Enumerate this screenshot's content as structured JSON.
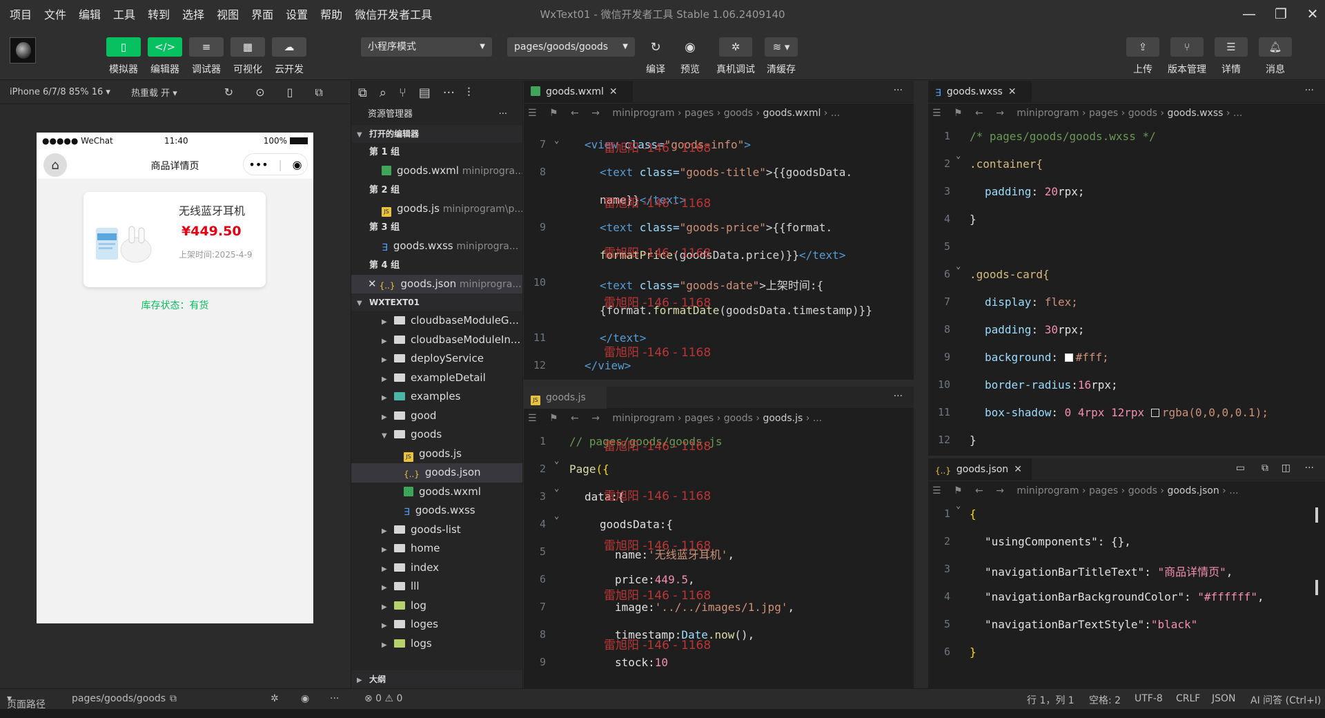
{
  "menu": [
    "项目",
    "文件",
    "编辑",
    "工具",
    "转到",
    "选择",
    "视图",
    "界面",
    "设置",
    "帮助",
    "微信开发者工具"
  ],
  "window": {
    "title": "WxText01 - 微信开发者工具 Stable 1.06.2409140"
  },
  "toolbar": {
    "left": [
      "模拟器",
      "编辑器",
      "调试器",
      "可视化",
      "云开发"
    ],
    "mode": "小程序模式",
    "page": "pages/goods/goods",
    "actions": [
      "编译",
      "预览",
      "真机调试",
      "清缓存"
    ],
    "right": [
      "上传",
      "版本管理",
      "详情",
      "消息"
    ]
  },
  "simulator": {
    "device": "iPhone 6/7/8 85% 16",
    "hot_reload": "热重载 开",
    "status": {
      "carrier": "●●●●● WeChat",
      "time": "11:40",
      "battery": "100%"
    },
    "nav_title": "商品详情页",
    "goods": {
      "name": "无线蓝牙耳机",
      "price": "¥449.50",
      "date": "上架时间:2025-4-9"
    },
    "stock": "库存状态：有货"
  },
  "explorer": {
    "title": "资源管理器",
    "open_editors": "打开的编辑器",
    "groups": [
      {
        "label": "第 1 组",
        "file": "goods.wxml",
        "path": "miniprogra..."
      },
      {
        "label": "第 2 组",
        "file": "goods.js",
        "path": "miniprogram\\p..."
      },
      {
        "label": "第 3 组",
        "file": "goods.wxss",
        "path": "miniprogra..."
      },
      {
        "label": "第 4 组",
        "file": "goods.json",
        "path": "miniprogra..."
      }
    ],
    "project": "WXTEXT01",
    "tree_before": [
      "cloudbaseModuleG...",
      "cloudbaseModuleIn...",
      "deployService",
      "exampleDetail",
      "examples",
      "good"
    ],
    "goods_folder": "goods",
    "goods_files": [
      "goods.js",
      "goods.json",
      "goods.wxml",
      "goods.wxss"
    ],
    "tree_after": [
      "goods-list",
      "home",
      "index",
      "lll",
      "log",
      "loges",
      "logs"
    ],
    "outline": "大纲"
  },
  "crumb_common": [
    "miniprogram",
    "pages",
    "goods"
  ],
  "wxml": {
    "tab": "goods.wxml",
    "crumb_file": "goods.wxml",
    "lines": [
      "7",
      "8",
      "",
      "9",
      "",
      "10",
      "",
      "11",
      "12"
    ],
    "code": {
      "l1_tag": "<view",
      "l1_attr": " class=",
      "l1_str": "\"goods-info\"",
      "l1_end": ">",
      "l2_tag": "<text",
      "l2_attr": " class=",
      "l2_str": "\"goods-title\"",
      "l2_end": ">{{goodsData.",
      "l3": "name}}",
      "l3_tag": "</text>",
      "l4_tag": "<text",
      "l4_attr": " class=",
      "l4_str": "\"goods-price\"",
      "l4_end": ">{{format.",
      "l5_fn": "formatPrice",
      "l5_rest": "(goodsData.price)}}",
      "l5_tag": "</text>",
      "l6_tag": "<text",
      "l6_attr": " class=",
      "l6_str": "\"goods-date\"",
      "l6_end": ">上架时间:{",
      "l7a": "{format.",
      "l7_fn": "formatDate",
      "l7_rest": "(goodsData.timestamp)}}",
      "l8_tag": "</text>",
      "l9_tag": "</view>"
    }
  },
  "js": {
    "tab": "goods.js",
    "crumb_file": "goods.js",
    "lines": [
      "1",
      "2",
      "3",
      "4",
      "5",
      "6",
      "7",
      "8",
      "9"
    ],
    "code": {
      "l1": "// pages/goods/goods.js",
      "l2_fn": "Page",
      "l2_rest": "({",
      "l3": "data:{",
      "l4": "goodsData:{",
      "l5_k": "name:",
      "l5_v": "'无线蓝牙耳机'",
      "l5_c": ",",
      "l6_k": "price:",
      "l6_v": "449.5",
      "l6_c": ",",
      "l7_k": "image:",
      "l7_v": "'../../images/1.jpg'",
      "l7_c": ",",
      "l8_k": "timestamp:",
      "l8_o": "Date",
      "l8_m": ".now",
      "l8_c": "(),",
      "l9_k": "stock:",
      "l9_v": "10"
    }
  },
  "wxss": {
    "tab": "goods.wxss",
    "crumb_file": "goods.wxss",
    "lines": [
      "1",
      "2",
      "3",
      "4",
      "5",
      "6",
      "7",
      "8",
      "9",
      "10",
      "11",
      "12"
    ],
    "code": {
      "l1": "/* pages/goods/goods.wxss */",
      "l2": ".container{",
      "l3_p": "padding",
      "l3_v": "20",
      "l3_u": "rpx;",
      "l4": "}",
      "l6": ".goods-card{",
      "l7_p": "display",
      "l7_v": "flex;",
      "l8_p": "padding",
      "l8_v": "30",
      "l8_u": "rpx;",
      "l9_p": "background",
      "l9_v": "#fff;",
      "l10_p": "border-radius",
      "l10_v": "16",
      "l10_u": "rpx;",
      "l11_p": "box-shadow",
      "l11_v": "0 4rpx 12rpx",
      "l11_f": "rgba(0,0,0,0.1);",
      "l12": "}"
    }
  },
  "json": {
    "tab": "goods.json",
    "crumb_file": "goods.json",
    "lines": [
      "1",
      "2",
      "3",
      "4",
      "5",
      "6"
    ],
    "code": {
      "l1": "{",
      "l2_k": "\"usingComponents\"",
      "l2_v": ": {},",
      "l3_k": "\"navigationBarTitleText\"",
      "l3_s": "\"商品详情页\"",
      "l4_k": "\"navigationBarBackgroundColor\"",
      "l4_s": "\"#ffffff\"",
      "l5_k": "\"navigationBarTextStyle\"",
      "l5_s": "\"black\"",
      "l6": "}"
    }
  },
  "watermark": "雷旭阳 -146 - 1168",
  "statusbar": {
    "path_label": "页面路径",
    "path": "pages/goods/goods",
    "problems": "⊗ 0 ⚠ 0",
    "cursor": "行 1，列 1",
    "spaces": "空格: 2",
    "encoding": "UTF-8",
    "eol": "CRLF",
    "lang": "JSON",
    "ai": "AI 问答 (Ctrl+I)"
  }
}
